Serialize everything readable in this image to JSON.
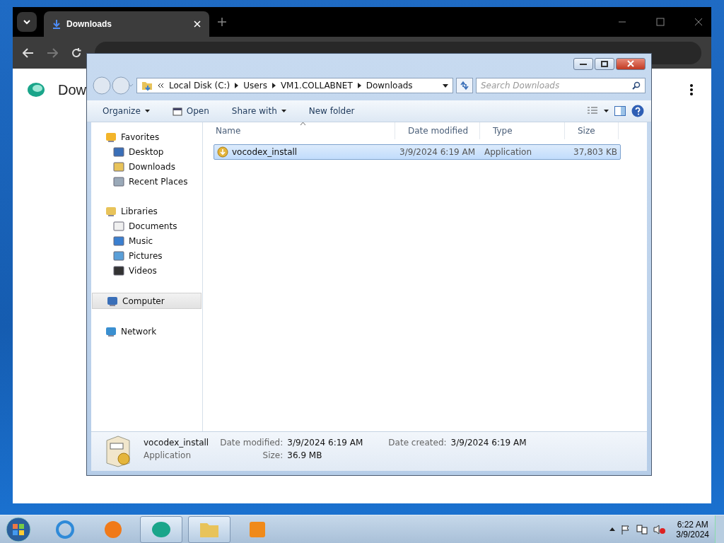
{
  "browser": {
    "tab_title": "Downloads",
    "page_title": "Dow"
  },
  "explorer": {
    "breadcrumb": [
      "Local Disk (C:)",
      "Users",
      "VM1.COLLABNET",
      "Downloads"
    ],
    "search": {
      "placeholder": "Search Downloads"
    },
    "toolbar": [
      {
        "label": "Organize",
        "has_menu": true
      },
      {
        "label": "Open",
        "has_menu": false
      },
      {
        "label": "Share with",
        "has_menu": true
      },
      {
        "label": "New folder",
        "has_menu": false
      }
    ],
    "nav": [
      {
        "label": "Favorites",
        "selected": false,
        "children": [
          {
            "label": "Desktop",
            "selected": false
          },
          {
            "label": "Downloads",
            "selected": false
          },
          {
            "label": "Recent Places",
            "selected": false
          }
        ]
      },
      {
        "label": "Libraries",
        "selected": false,
        "children": [
          {
            "label": "Documents",
            "selected": false
          },
          {
            "label": "Music",
            "selected": false
          },
          {
            "label": "Pictures",
            "selected": false
          },
          {
            "label": "Videos",
            "selected": false
          }
        ]
      },
      {
        "label": "Computer",
        "selected": true
      },
      {
        "label": "Network",
        "selected": false
      }
    ],
    "columns": [
      "Name",
      "Date modified",
      "Type",
      "Size"
    ],
    "files": [
      {
        "name": "vocodex_install",
        "date_modified": "3/9/2024 6:19 AM",
        "type": "Application",
        "size": "37,803 KB",
        "selected": true
      }
    ],
    "details": {
      "name": "vocodex_install",
      "type": "Application",
      "fields": [
        {
          "label": "Date modified:",
          "value": "3/9/2024 6:19 AM"
        },
        {
          "label": "Size:",
          "value": "36.9 MB"
        },
        {
          "label": "Date created:",
          "value": "3/9/2024 6:19 AM"
        }
      ]
    }
  },
  "taskbar": {
    "apps": [
      {
        "running": false
      },
      {
        "running": false
      },
      {
        "running": true
      },
      {
        "running": true
      },
      {
        "running": false
      }
    ],
    "time": "6:22 AM",
    "date": "3/9/2024"
  }
}
